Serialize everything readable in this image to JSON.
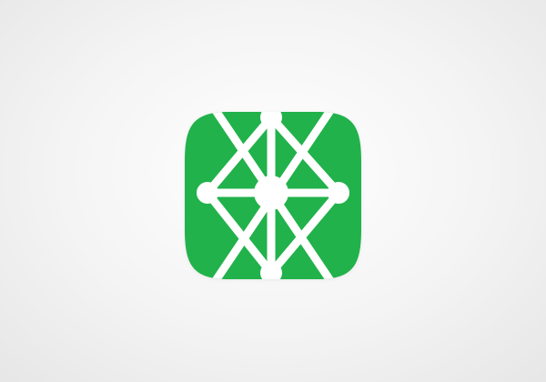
{
  "app_icon": {
    "name": "network-hub-icon",
    "background_color": "#21b24b",
    "glyph_color": "#ffffff",
    "shape": "rounded-square"
  }
}
